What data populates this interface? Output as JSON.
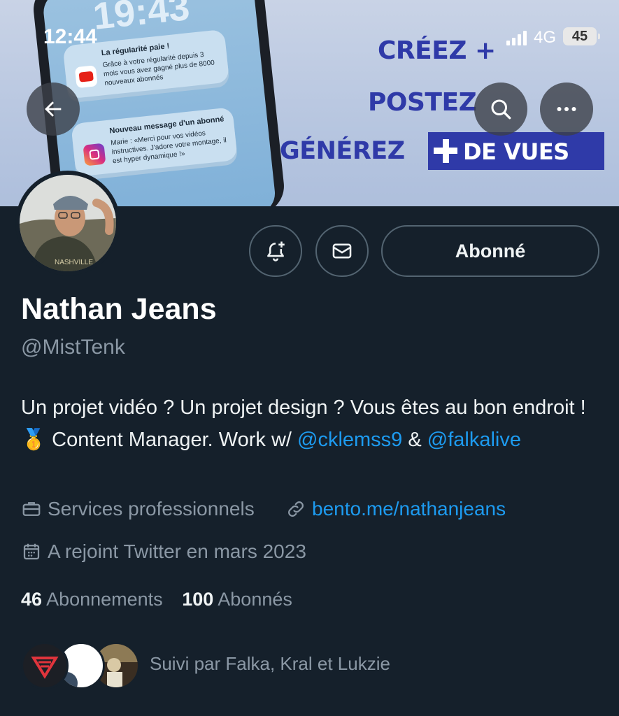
{
  "status_bar": {
    "time": "12:44",
    "network": "4G",
    "battery": "45"
  },
  "banner": {
    "phone_time": "19:43",
    "notifications": [
      {
        "title": "La régularité paie !",
        "text": "Grâce à votre régularité depuis 3 mois vous avez gagné plus de 8000 nouveaux abonnés"
      },
      {
        "title": "Nouveau message d'un abonné",
        "text": "Marie : «Merci pour vos vidéos instructives. J'adore votre montage, il est hyper dynamique !»"
      }
    ],
    "slogans": [
      "CRÉEZ +",
      "POSTEZ",
      "GÉNÉREZ",
      "DE VUES"
    ],
    "slogan_color": "#2f3aa8"
  },
  "nav": {
    "back_icon": "arrow-left-icon",
    "search_icon": "search-icon",
    "more_icon": "more-horizontal-icon"
  },
  "profile": {
    "name": "Nathan Jeans",
    "handle": "@MistTenk",
    "bio_text_1": "Un projet vidéo ? Un projet design ? Vous êtes au bon endroit ! ",
    "bio_emoji": "🥇",
    "bio_text_2": " Content Manager. Work w/ ",
    "mention_1": "@cklemss9",
    "bio_text_3": " & ",
    "mention_2": "@falkalive",
    "category": "Services professionnels",
    "website": "bento.me/nathanjeans",
    "joined": "A rejoint Twitter en mars 2023",
    "following_count": "46",
    "following_label": "Abonnements",
    "followers_count": "100",
    "followers_label": "Abonnés",
    "followed_by": "Suivi par Falka, Kral et Lukzie"
  },
  "actions": {
    "notify_icon": "bell-plus-icon",
    "message_icon": "envelope-icon",
    "follow_label": "Abonné"
  },
  "colors": {
    "background": "#15202b",
    "link": "#1d9bf0",
    "secondary_text": "#8b98a5"
  }
}
